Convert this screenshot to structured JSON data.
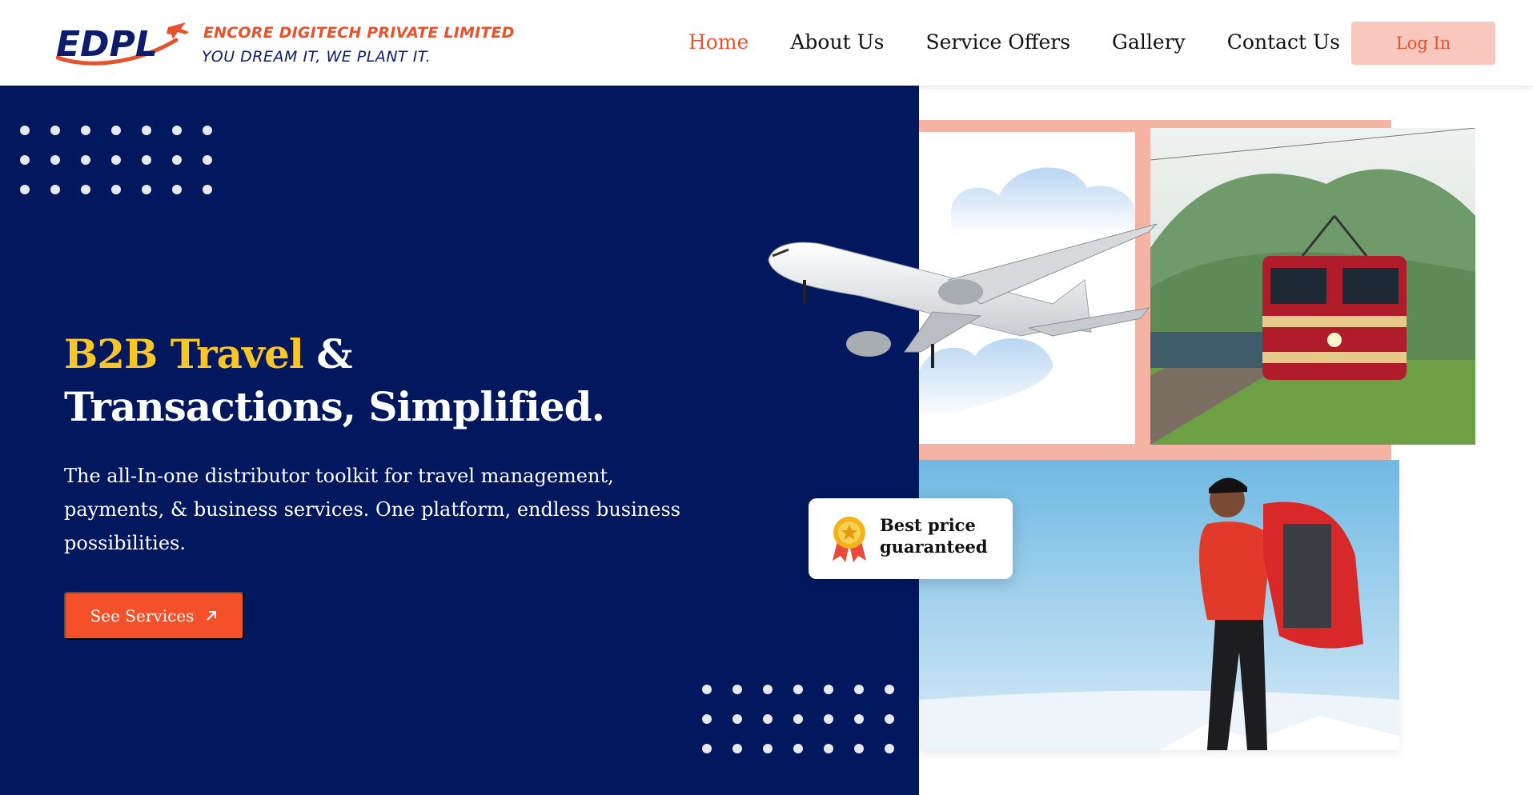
{
  "brand": {
    "logo_text": "EDPL",
    "company_name": "ENCORE DIGITECH PRIVATE LIMITED",
    "tagline": "YOU DREAM IT, WE PLANT IT.",
    "colors": {
      "orange": "#e5532e",
      "navy": "#0e1d6b"
    }
  },
  "nav": {
    "items": [
      {
        "label": "Home",
        "active": true
      },
      {
        "label": "About Us",
        "active": false
      },
      {
        "label": "Service Offers",
        "active": false
      },
      {
        "label": "Gallery",
        "active": false
      },
      {
        "label": "Contact Us",
        "active": false
      }
    ],
    "login_label": "Log In"
  },
  "hero": {
    "headline_highlight": "B2B Travel",
    "headline_rest_line1": "&",
    "headline_line2": "Transactions, Simplified.",
    "subtext": "The all-In-one distributor toolkit for travel management, payments, & business services. One platform, endless business possibilities.",
    "cta_label": "See Services",
    "cta_icon": "arrow-up-right-icon",
    "colors": {
      "background": "#01185e",
      "highlight": "#f8c627",
      "cta": "#f4512b"
    }
  },
  "badge": {
    "line1": "Best price",
    "line2": "guaranteed",
    "icon": "medal-icon"
  },
  "images": {
    "plane": "airplane-image",
    "clouds": "clouds-image",
    "train": "train-image",
    "hiker": "hiker-image"
  }
}
